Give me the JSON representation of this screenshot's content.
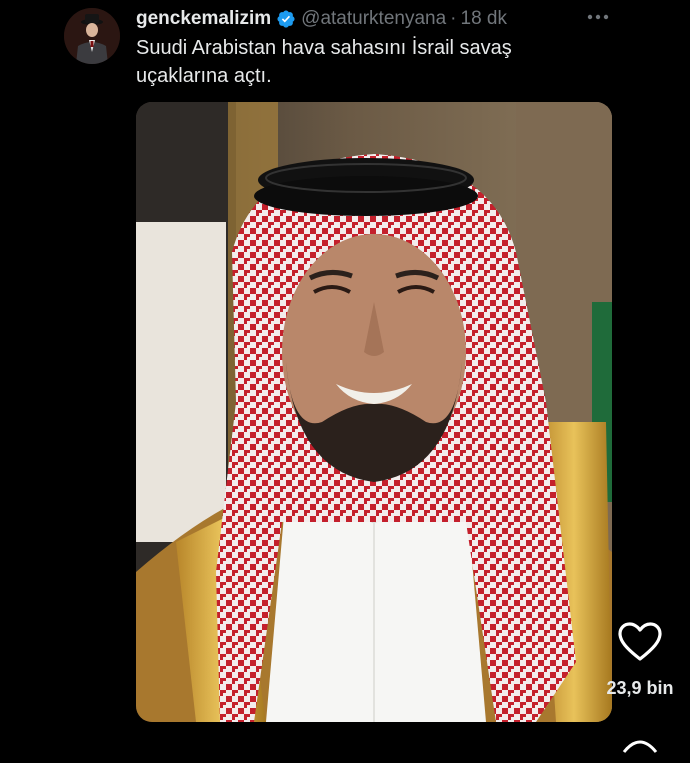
{
  "tweet": {
    "display_name": "genckemalizim",
    "handle": "@ataturktenyana",
    "separator": "·",
    "time": "18 dk",
    "text": "Suudi Arabistan hava sahasını İsrail savaş uçaklarına açtı."
  },
  "actions": {
    "like_count": "23,9 bin"
  },
  "icons": {
    "verified": "verified-badge-icon",
    "more": "more-options-icon",
    "like": "heart-icon"
  },
  "colors": {
    "background": "#000000",
    "text": "#e7e9ea",
    "muted": "#71767b",
    "verified": "#1d9bf0"
  }
}
